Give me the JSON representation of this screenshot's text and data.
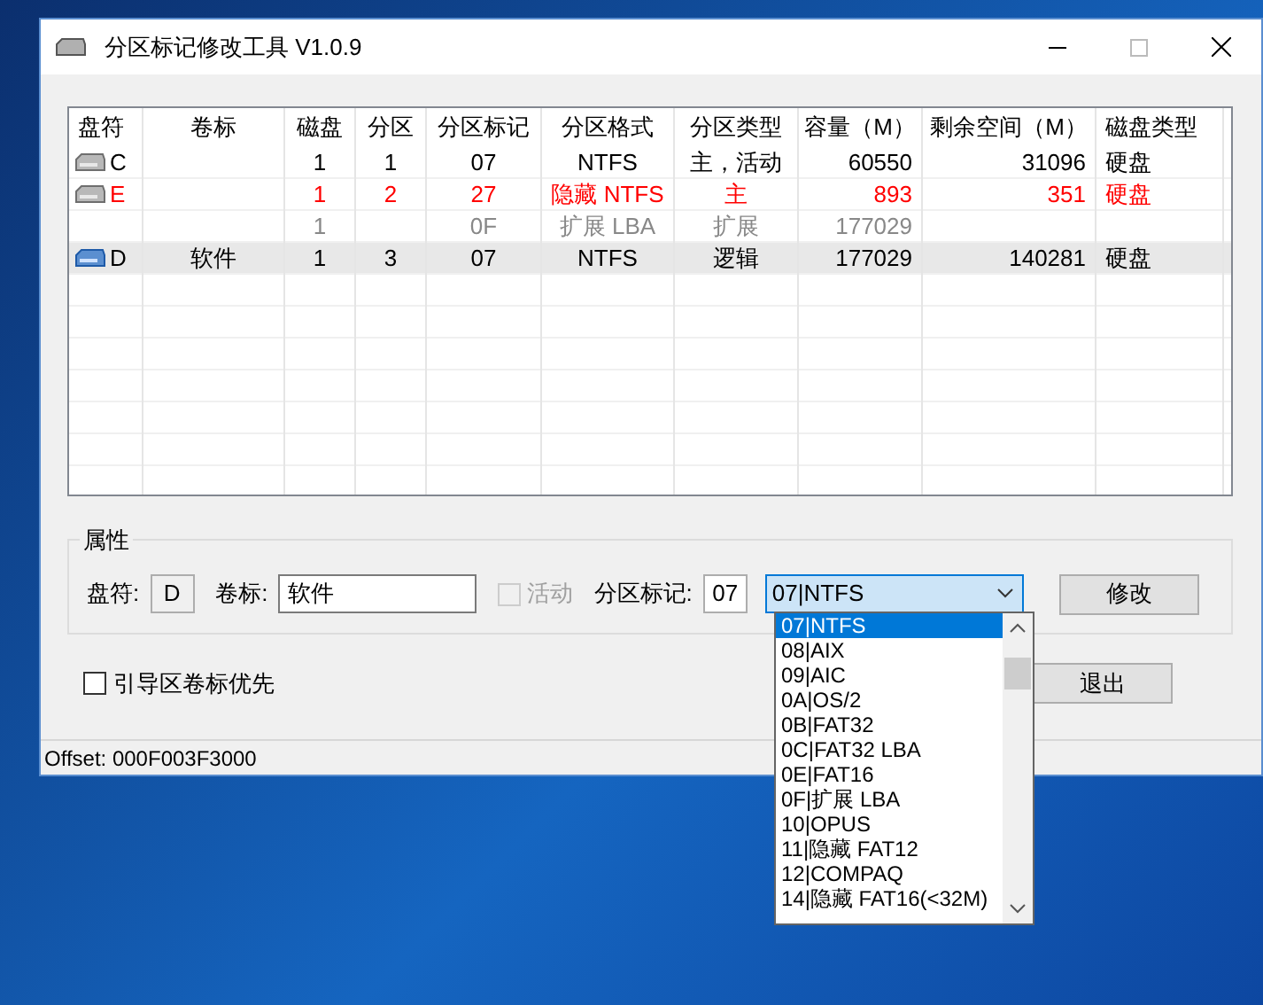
{
  "window": {
    "title": "分区标记修改工具 V1.0.9"
  },
  "table": {
    "columns": [
      "盘符",
      "卷标",
      "磁盘",
      "分区",
      "分区标记",
      "分区格式",
      "分区类型",
      "容量（M）",
      "剩余空间（M）",
      "磁盘类型"
    ],
    "rows": [
      {
        "kind": "normal",
        "selected": false,
        "drive": "C",
        "disk": "1",
        "partition": "1",
        "tag": "07",
        "format": "NTFS",
        "type": "主，活动",
        "capacity": "60550",
        "free": "31096",
        "disk_type": "硬盘"
      },
      {
        "kind": "hidden",
        "selected": false,
        "drive": "E",
        "disk": "1",
        "partition": "2",
        "tag": "27",
        "format": "隐藏 NTFS",
        "type": "主",
        "capacity": "893",
        "free": "351",
        "disk_type": "硬盘"
      },
      {
        "kind": "extended",
        "selected": false,
        "disk": "1",
        "tag": "0F",
        "format": "扩展 LBA",
        "type": "扩展",
        "capacity": "177029"
      },
      {
        "kind": "normal",
        "selected": true,
        "drive": "D",
        "label": "软件",
        "disk": "1",
        "partition": "3",
        "tag": "07",
        "format": "NTFS",
        "type": "逻辑",
        "capacity": "177029",
        "free": "140281",
        "disk_type": "硬盘"
      }
    ]
  },
  "properties": {
    "title": "属性",
    "drive_label": "盘符:",
    "drive_value": "D",
    "volume_label": "卷标:",
    "volume_value": "软件",
    "active": {
      "label": "活动",
      "checked": false,
      "disabled": true
    },
    "tag_label": "分区标记:",
    "tag_value": "07",
    "combo_value": "07|NTFS",
    "modify_button": "修改"
  },
  "boot_checkbox": {
    "label": "引导区卷标优先",
    "checked": false
  },
  "exit_button": "退出",
  "status_bar": "Offset: 000F003F3000",
  "dropdown": {
    "items": [
      {
        "label": "07|NTFS",
        "selected": true
      },
      {
        "label": "08|AIX",
        "selected": false
      },
      {
        "label": "09|AIC",
        "selected": false
      },
      {
        "label": "0A|OS/2",
        "selected": false
      },
      {
        "label": "0B|FAT32",
        "selected": false
      },
      {
        "label": "0C|FAT32 LBA",
        "selected": false
      },
      {
        "label": "0E|FAT16",
        "selected": false
      },
      {
        "label": "0F|扩展 LBA",
        "selected": false
      },
      {
        "label": "10|OPUS",
        "selected": false
      },
      {
        "label": "11|隐藏 FAT12",
        "selected": false
      },
      {
        "label": "12|COMPAQ",
        "selected": false
      },
      {
        "label": "14|隐藏 FAT16(<32M)",
        "selected": false
      }
    ]
  }
}
